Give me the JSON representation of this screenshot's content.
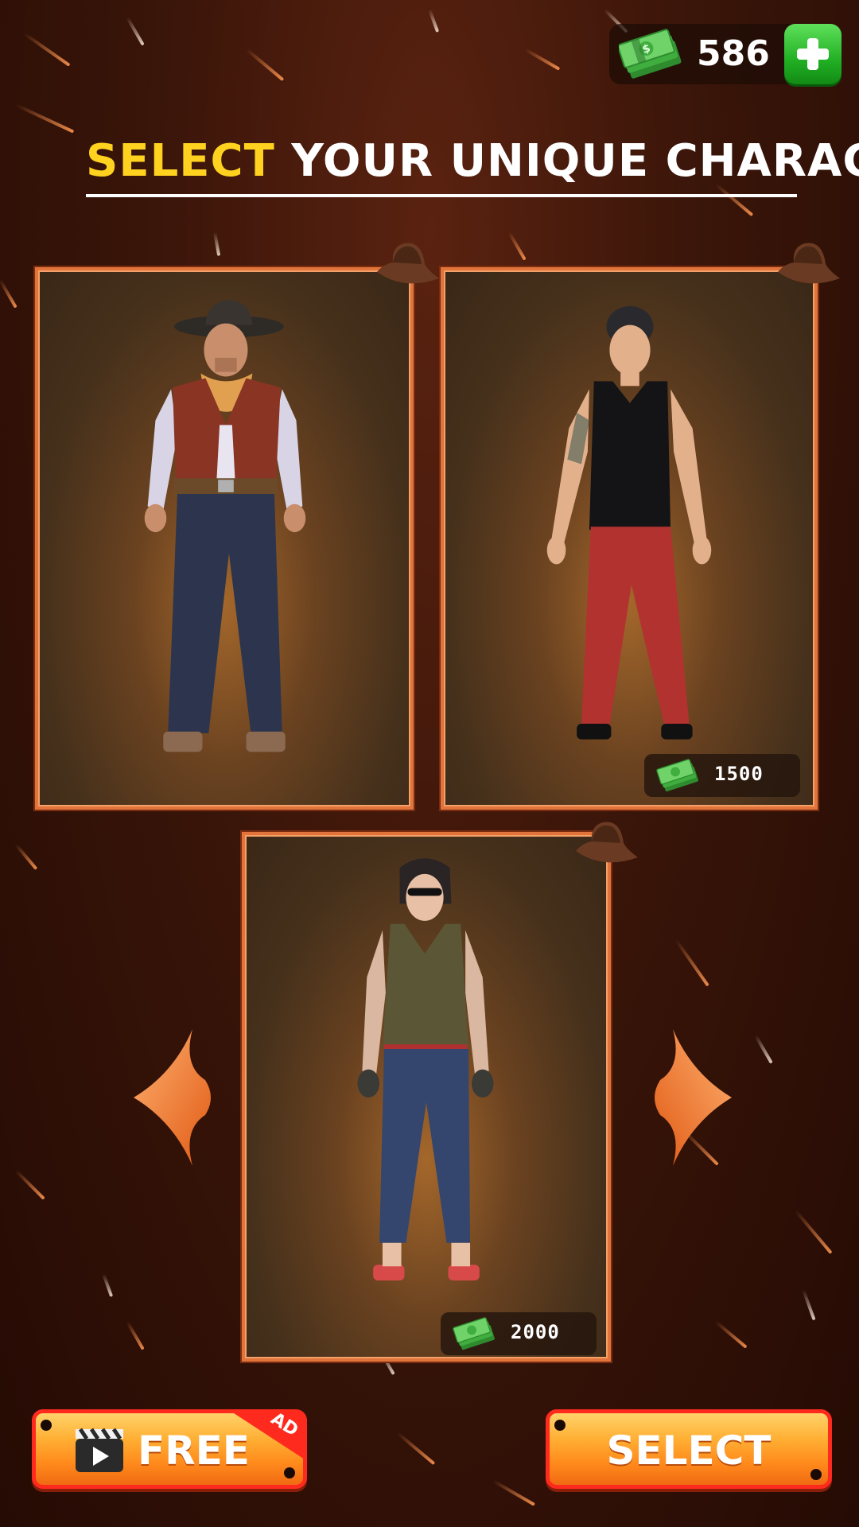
{
  "header": {
    "currency_amount": "586",
    "currency_icon": "cash-stack-icon",
    "add_icon": "plus-icon"
  },
  "title": {
    "highlight": "SELECT",
    "rest": "YOUR UNIQUE CHARACTER",
    "highlight_color": "#ffd21f"
  },
  "characters": [
    {
      "id": "cowboy",
      "price": null
    },
    {
      "id": "tank-top-man",
      "price": "1500"
    },
    {
      "id": "tattooed-woman",
      "price": "2000"
    }
  ],
  "buttons": {
    "free_label": "FREE",
    "ad_badge": "AD",
    "select_label": "SELECT"
  },
  "colors": {
    "accent_orange": "#ff8a1c",
    "button_border": "#ff2a1e",
    "green_button": "#22b024",
    "card_border": "#e0743a"
  }
}
